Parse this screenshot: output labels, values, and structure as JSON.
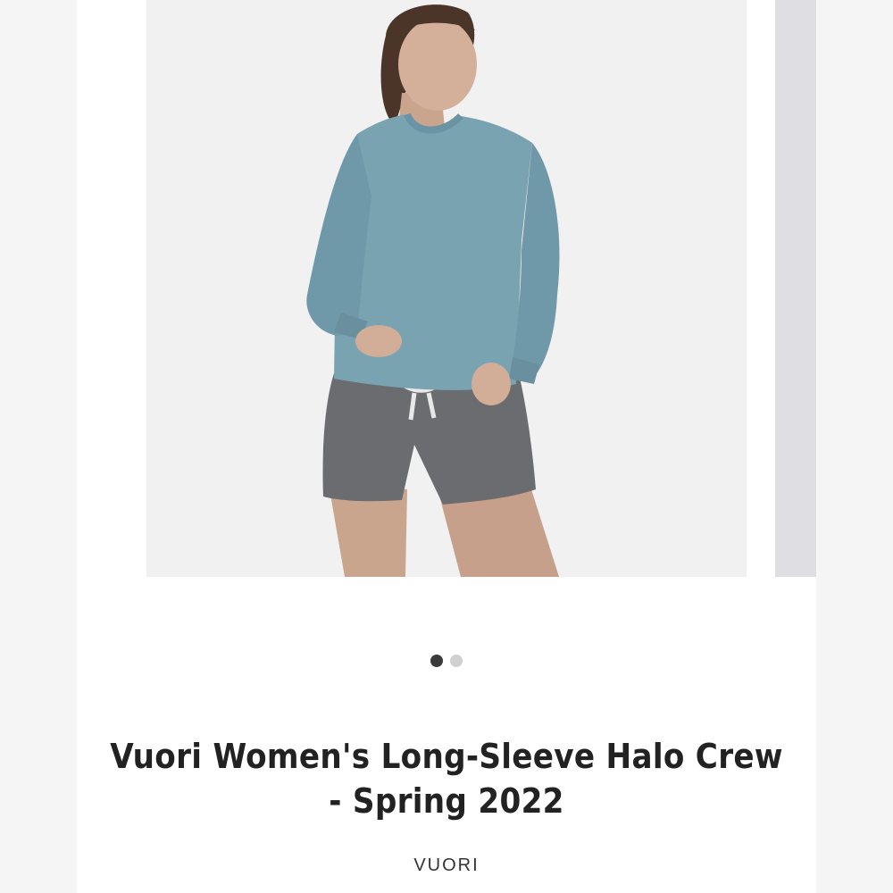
{
  "product": {
    "title": "Vuori Women's Long-Sleeve Halo Crew - Spring 2022",
    "brand": "VUORI"
  },
  "gallery": {
    "slide_count": 2,
    "active_index": 0
  },
  "colors": {
    "sweater": "#7aa3b2",
    "shorts": "#6b6c70",
    "photo_background": "#f1f1f2",
    "active_dot": "#3a3a3a",
    "inactive_dot": "#d0d0d0"
  }
}
